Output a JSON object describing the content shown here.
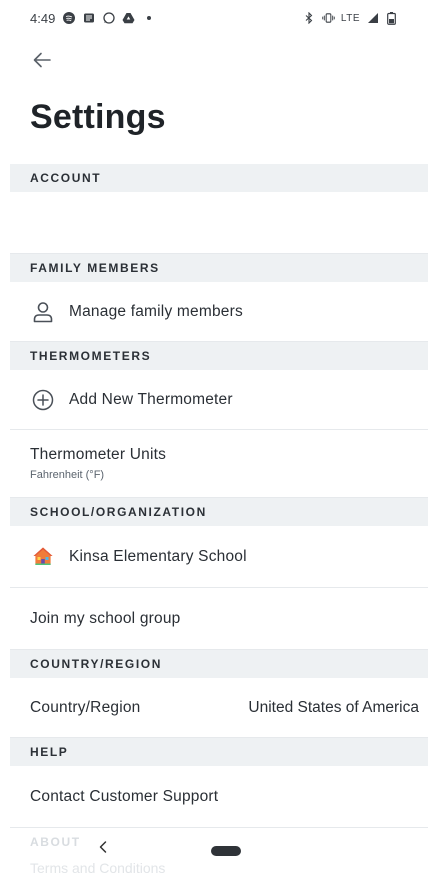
{
  "status_bar": {
    "time": "4:49",
    "network": "LTE"
  },
  "page": {
    "title": "Settings"
  },
  "sections": {
    "account": {
      "header": "ACCOUNT"
    },
    "family": {
      "header": "FAMILY MEMBERS",
      "manage_label": "Manage family members"
    },
    "thermometers": {
      "header": "THERMOMETERS",
      "add_label": "Add New Thermometer",
      "units_label": "Thermometer Units",
      "units_value": "Fahrenheit (°F)"
    },
    "school": {
      "header": "SCHOOL/ORGANIZATION",
      "school_name": "Kinsa Elementary School",
      "join_label": "Join my school group"
    },
    "country": {
      "header": "COUNTRY/REGION",
      "label": "Country/Region",
      "value": "United States of America"
    },
    "help": {
      "header": "HELP",
      "contact_label": "Contact Customer Support"
    },
    "about": {
      "header": "ABOUT",
      "terms_label": "Terms and Conditions"
    }
  },
  "icons": {
    "back": "arrow-left-icon",
    "person": "person-icon",
    "add": "plus-circle-icon",
    "school": "school-house-icon"
  },
  "colors": {
    "section_bg": "#eef1f3",
    "text": "#1f2328",
    "school_icon": "#f07c3a"
  }
}
